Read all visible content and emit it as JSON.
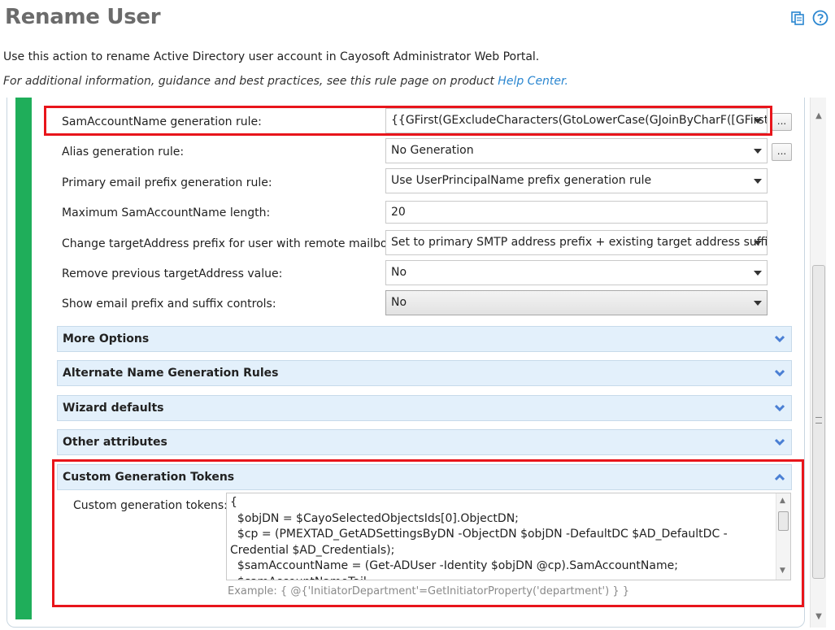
{
  "header": {
    "title": "Rename User",
    "description": "Use this action to rename Active Directory user account in Cayosoft Administrator Web Portal.",
    "info_prefix": "For additional information, guidance and best practices, see this rule page on product ",
    "help_link": "Help Center.",
    "icons": [
      "copy-icon",
      "help-icon"
    ]
  },
  "fields": [
    {
      "label": "SamAccountName generation rule:",
      "value": "{{GFirst(GExcludeCharacters(GtoLowerCase(GJoinByCharF([GFirst(G",
      "type": "select"
    },
    {
      "label": "Alias generation rule:",
      "value": "No Generation",
      "type": "select"
    },
    {
      "label": "Primary email prefix generation rule:",
      "value": "Use UserPrincipalName prefix generation rule",
      "type": "select"
    },
    {
      "label": "Maximum SamAccountName length:",
      "value": "20",
      "type": "input"
    },
    {
      "label": "Change targetAddress prefix for user with remote mailbox:",
      "value": "Set to primary SMTP address prefix + existing target address suffix",
      "type": "select"
    },
    {
      "label": "Remove previous targetAddress value:",
      "value": "No",
      "type": "select"
    },
    {
      "label": "Show email prefix and suffix controls:",
      "value": "No",
      "type": "select"
    }
  ],
  "ellipsis_label": "...",
  "sections": [
    {
      "label": "More Options",
      "state": "collapsed"
    },
    {
      "label": "Alternate Name Generation Rules",
      "state": "collapsed"
    },
    {
      "label": "Wizard defaults",
      "state": "collapsed"
    },
    {
      "label": "Other attributes",
      "state": "collapsed"
    },
    {
      "label": "Custom Generation Tokens",
      "state": "expanded"
    }
  ],
  "custom_tokens": {
    "label": "Custom generation tokens:",
    "value": "{\n  $objDN = $CayoSelectedObjectsIds[0].ObjectDN;\n  $cp = (PMEXTAD_GetADSettingsByDN -ObjectDN $objDN -DefaultDC $AD_DefaultDC -Credential $AD_Credentials);\n  $samAccountName = (Get-ADUser -Identity $objDN @cp).SamAccountName;\n  $samAccountNameTail = ...",
    "example": "Example: { @{'InitiatorDepartment'=GetInitiatorProperty('department') } }"
  },
  "colors": {
    "accent_green": "#1fae5a",
    "highlight_red": "#e8151b",
    "section_bg": "#e3f0fb",
    "link_blue": "#2a86d0",
    "chevron_blue": "#4a7fd4"
  }
}
